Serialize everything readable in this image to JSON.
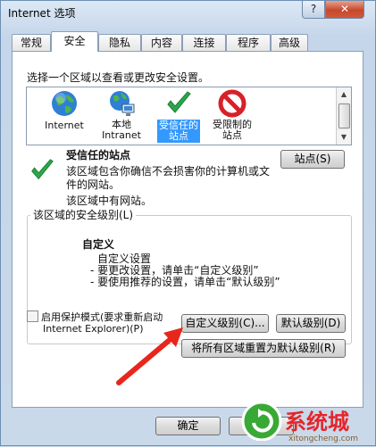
{
  "window": {
    "title": "Internet 选项",
    "help_glyph": "?",
    "close_glyph": "✕"
  },
  "tabs": [
    "常规",
    "安全",
    "隐私",
    "内容",
    "连接",
    "程序",
    "高级"
  ],
  "active_tab": "安全",
  "instruction": "选择一个区域以查看或更改安全设置。",
  "zones": [
    {
      "line1": "Internet",
      "line2": "",
      "icon": "globe-icon"
    },
    {
      "line1": "本地",
      "line2": "Intranet",
      "icon": "globe-computer-icon"
    },
    {
      "line1": "受信任的",
      "line2": "站点",
      "icon": "green-check-icon"
    },
    {
      "line1": "受限制的",
      "line2": "站点",
      "icon": "restricted-icon"
    }
  ],
  "selected_zone": {
    "title": "受信任的站点",
    "desc_line1": "该区域包含你确信不会损害你的计算机或文",
    "desc_line2": "件的网站。",
    "note": "该区域中有网站。"
  },
  "sites_button": "站点(S)",
  "security_level": {
    "legend": "该区域的安全级别(L)",
    "level_name": "自定义",
    "line1": "自定义设置",
    "line2": "- 要更改设置，请单击“自定义级别”",
    "line3": "- 要使用推荐的设置，请单击“默认级别”"
  },
  "protected_mode": {
    "line1": "启用保护模式(要求重新启动",
    "line2": "Internet Explorer)(P)",
    "checked": false
  },
  "buttons": {
    "custom_level": "自定义级别(C)...",
    "default_level": "默认级别(D)",
    "reset_all": "将所有区域重置为默认级别(R)",
    "ok": "确定"
  },
  "watermark": {
    "text": "系统城",
    "url": "xitongcheng.com"
  },
  "colors": {
    "selection": "#3399ff",
    "annotation_arrow": "#e8261c",
    "window_frame": "#c9d9ea"
  }
}
